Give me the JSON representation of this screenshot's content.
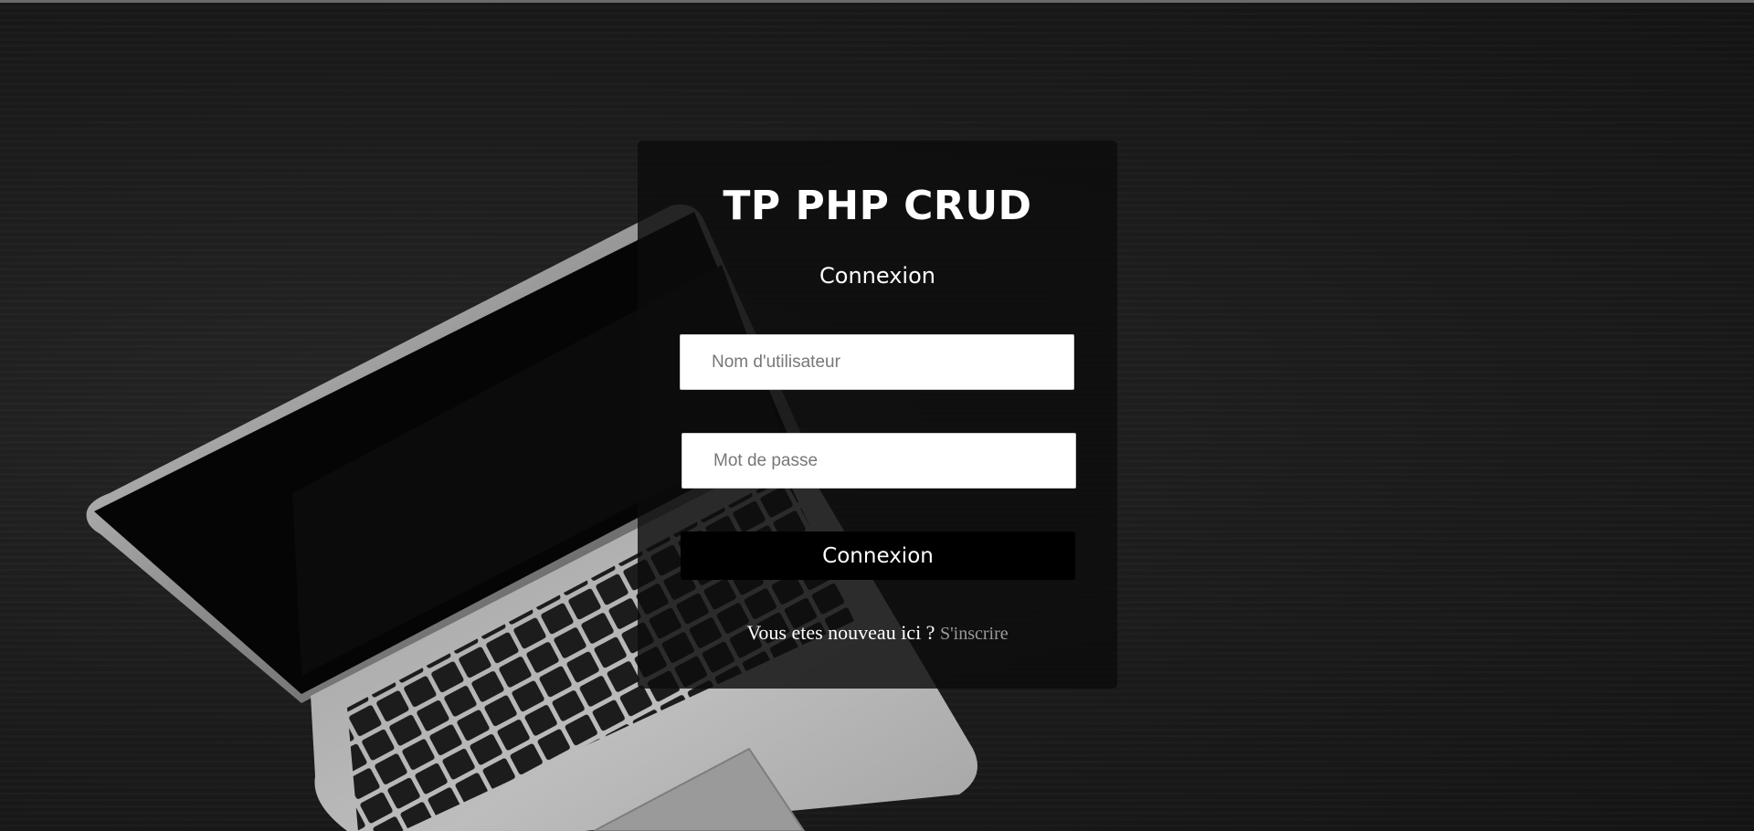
{
  "login": {
    "title": "TP PHP CRUD",
    "subtitle": "Connexion",
    "username_placeholder": "Nom d'utilisateur",
    "password_placeholder": "Mot de passe",
    "submit_label": "Connexion",
    "signup_prompt": "Vous etes nouveau ici ?",
    "signup_link": "S'inscrire"
  },
  "colors": {
    "background": "#1b1b1b",
    "card": "#0c0c0c",
    "button": "#000000",
    "link": "#9a9a9a"
  },
  "icons": [
    "laptop-illustration"
  ]
}
